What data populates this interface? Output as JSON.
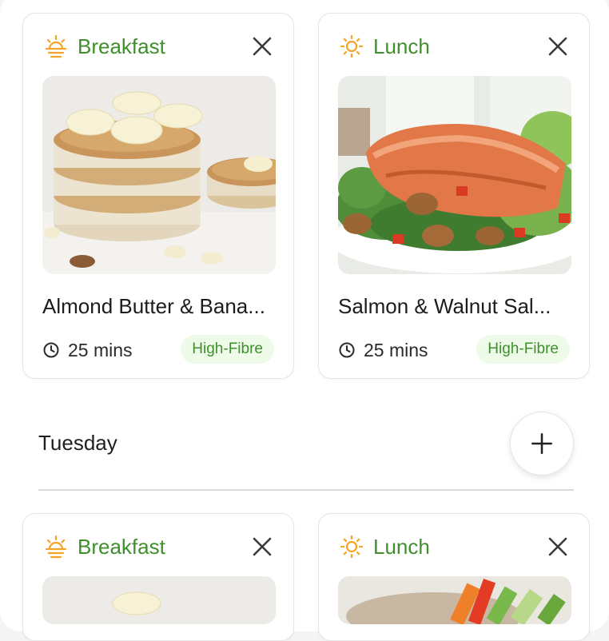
{
  "cards": [
    {
      "meal": "Breakfast",
      "title": "Almond Butter & Bana...",
      "time": "25 mins",
      "tag": "High-Fibre",
      "meal_icon": "sunrise-icon"
    },
    {
      "meal": "Lunch",
      "title": "Salmon & Walnut Sal...",
      "time": "25 mins",
      "tag": "High-Fibre",
      "meal_icon": "sun-icon"
    },
    {
      "meal": "Breakfast",
      "meal_icon": "sunrise-icon"
    },
    {
      "meal": "Lunch",
      "meal_icon": "sun-icon"
    }
  ],
  "day": {
    "label": "Tuesday"
  },
  "colors": {
    "accent_green": "#3f8f2c",
    "icon_orange": "#f3a325",
    "tag_bg": "#eefbe8"
  }
}
